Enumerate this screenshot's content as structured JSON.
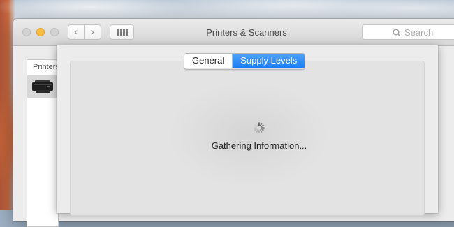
{
  "window": {
    "title": "Printers & Scanners",
    "nav_back": "‹",
    "nav_forward": "›",
    "search_placeholder": "Search"
  },
  "printer_list": {
    "header": "Printers",
    "icon": "printer-icon"
  },
  "sheet": {
    "tabs": [
      {
        "label": "General",
        "selected": false
      },
      {
        "label": "Supply Levels",
        "selected": true
      }
    ],
    "status_text": "Gathering Information...",
    "spinner_icon": "spinner-icon"
  },
  "colors": {
    "accent": "#1b7ff5",
    "minimize_button": "#fdbd41"
  }
}
